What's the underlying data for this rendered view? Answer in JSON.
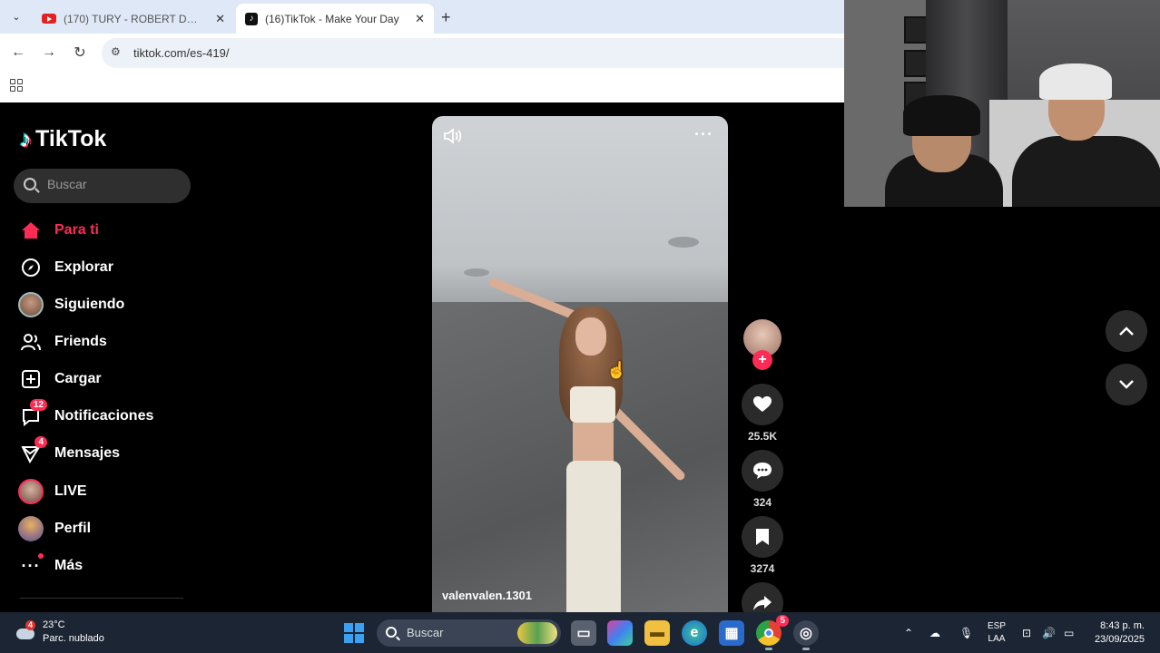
{
  "browser": {
    "tabs": [
      {
        "title": "(170) TURY - ROBERT DE NIRO",
        "icon": "youtube-icon"
      },
      {
        "title": "(16)TikTok - Make Your Day",
        "icon": "tiktok-icon"
      }
    ],
    "url": "tiktok.com/es-419/"
  },
  "tiktok": {
    "logo": "TikTok",
    "search_placeholder": "Buscar",
    "nav": [
      {
        "label": "Para ti",
        "icon": "home-icon",
        "active": true
      },
      {
        "label": "Explorar",
        "icon": "compass-icon"
      },
      {
        "label": "Siguiendo",
        "icon": "following-avatar-icon"
      },
      {
        "label": "Friends",
        "icon": "friends-icon"
      },
      {
        "label": "Cargar",
        "icon": "upload-icon"
      },
      {
        "label": "Notificaciones",
        "icon": "inbox-icon",
        "badge": "12"
      },
      {
        "label": "Mensajes",
        "icon": "send-icon",
        "badge": "4"
      },
      {
        "label": "LIVE",
        "icon": "live-avatar-icon"
      },
      {
        "label": "Perfil",
        "icon": "profile-avatar-icon"
      },
      {
        "label": "Más",
        "icon": "more-dots-icon"
      }
    ],
    "video": {
      "author": "valenvalen.1301",
      "likes": "25.5K",
      "comments": "324",
      "saves": "3274"
    }
  },
  "taskbar": {
    "weather_badge": "4",
    "temperature": "23°C",
    "condition": "Parc. nublado",
    "search_placeholder": "Buscar",
    "chrome_badge": "5",
    "language_top": "ESP",
    "language_bottom": "LAA",
    "time": "8:43 p. m.",
    "date": "23/09/2025"
  },
  "colors": {
    "accent": "#fe2c55",
    "taskbar": "#1c2533",
    "tab_strip": "#dfe8f6"
  }
}
